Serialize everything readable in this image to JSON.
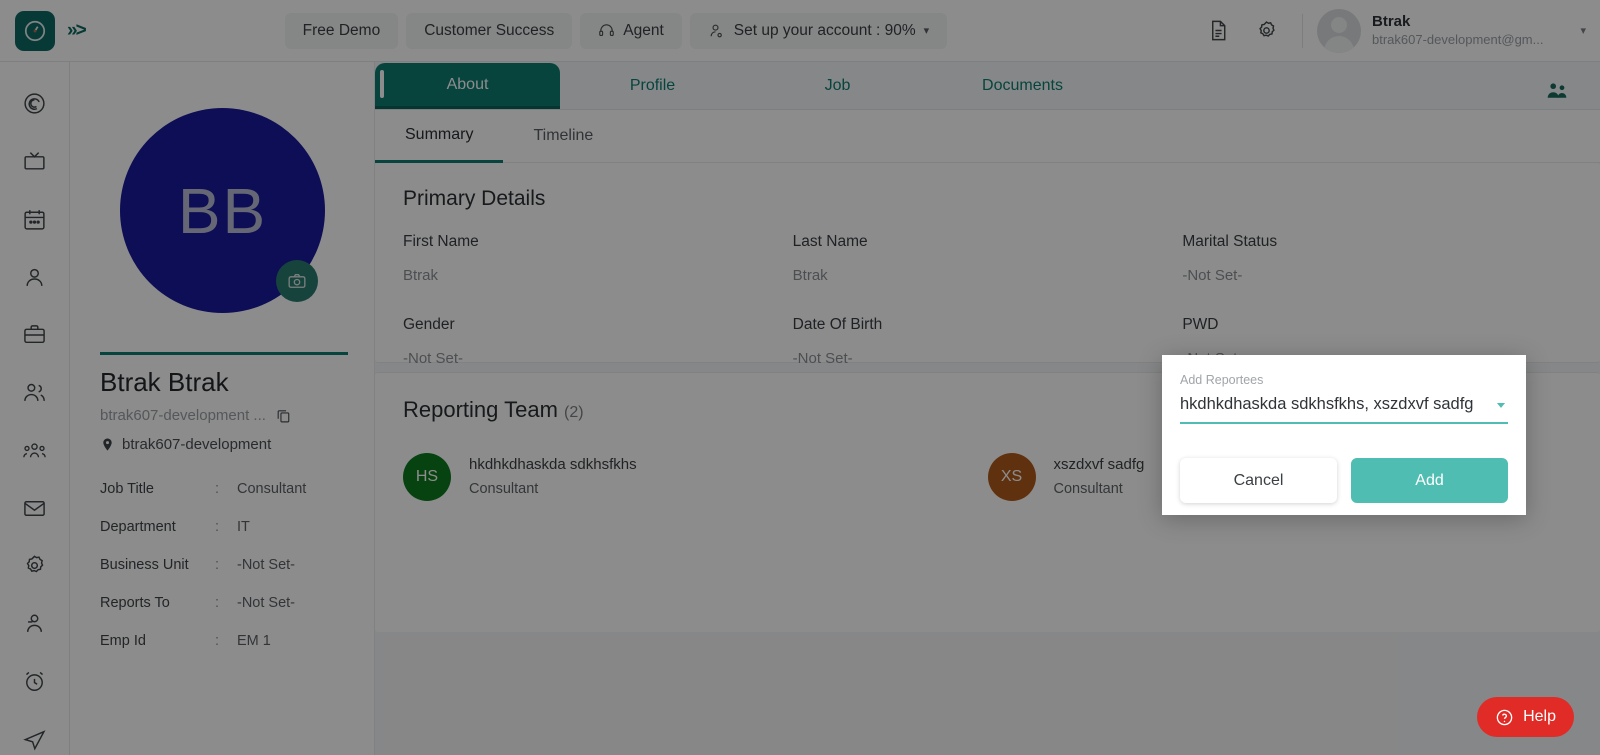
{
  "brand": {
    "logo_icon": "clock-logo-icon",
    "expand_icon": "chevron-triple-right-icon",
    "accent": "#0e7d72",
    "modal_accent": "#4fbdb2",
    "help_color": "#e02b27"
  },
  "topbar": {
    "nav": [
      {
        "label": "Free Demo",
        "icon": null
      },
      {
        "label": "Customer Success",
        "icon": null
      },
      {
        "label": "Agent",
        "icon": "headset-icon"
      },
      {
        "label": "Set up your account : 90%",
        "icon": "user-check-icon",
        "caret": true
      }
    ],
    "icons": [
      "document-icon",
      "gear-icon"
    ],
    "user": {
      "name": "Btrak",
      "email": "btrak607-development@gm...",
      "avatar_icon": "user-avatar-icon",
      "caret": "▾"
    }
  },
  "sidebar": {
    "items": [
      {
        "name": "dashboard",
        "icon": "spiral-target-icon"
      },
      {
        "name": "monitor",
        "icon": "tv-icon"
      },
      {
        "name": "calendar",
        "icon": "calendar-icon"
      },
      {
        "name": "employee",
        "icon": "person-icon"
      },
      {
        "name": "jobs",
        "icon": "briefcase-icon"
      },
      {
        "name": "people",
        "icon": "two-people-icon"
      },
      {
        "name": "teams",
        "icon": "group-people-icon"
      },
      {
        "name": "mail",
        "icon": "envelope-icon"
      },
      {
        "name": "settings",
        "icon": "gear-icon"
      },
      {
        "name": "account",
        "icon": "person-badge-icon"
      },
      {
        "name": "time",
        "icon": "alarm-clock-icon"
      },
      {
        "name": "send",
        "icon": "paper-plane-icon"
      }
    ]
  },
  "profile": {
    "initials": "BB",
    "camera_icon": "camera-icon",
    "name": "Btrak Btrak",
    "email": "btrak607-development ...",
    "copy_icon": "copy-icon",
    "location_icon": "location-pin-icon",
    "location": "btrak607-development",
    "fields": [
      {
        "label": "Job Title",
        "sep": ":",
        "value": "Consultant"
      },
      {
        "label": "Department",
        "sep": ":",
        "value": "IT"
      },
      {
        "label": "Business Unit",
        "sep": ":",
        "value": "-Not Set-"
      },
      {
        "label": "Reports To",
        "sep": ":",
        "value": "-Not Set-"
      },
      {
        "label": "Emp Id",
        "sep": ":",
        "value": "EM 1"
      }
    ]
  },
  "main": {
    "tabs": [
      {
        "label": "About",
        "active": true
      },
      {
        "label": "Profile",
        "active": false
      },
      {
        "label": "Job",
        "active": false
      },
      {
        "label": "Documents",
        "active": false
      }
    ],
    "subtabs": [
      {
        "label": "Summary",
        "active": true
      },
      {
        "label": "Timeline",
        "active": false
      }
    ],
    "team_icon": "team-people-icon",
    "primary_details": {
      "title": "Primary Details",
      "fields": [
        {
          "label": "First Name",
          "value": "Btrak"
        },
        {
          "label": "Last Name",
          "value": "Btrak"
        },
        {
          "label": "Marital Status",
          "value": "-Not Set-"
        },
        {
          "label": "Gender",
          "value": "-Not Set-"
        },
        {
          "label": "Date Of Birth",
          "value": "-Not Set-"
        },
        {
          "label": "PWD",
          "value": "-Not Set-"
        }
      ]
    },
    "reporting_team": {
      "title": "Reporting Team",
      "count": "(2)",
      "members": [
        {
          "initials": "HS",
          "color": "#0d7a1e",
          "name": "hkdhkdhaskda sdkhsfkhs",
          "role": "Consultant"
        },
        {
          "initials": "XS",
          "color": "#b05a1c",
          "name": "xszdxvf sadfg",
          "role": "Consultant"
        }
      ]
    }
  },
  "modal": {
    "label": "Add Reportees",
    "value": "hkdhkdhaskda sdkhsfkhs, xszdxvf sadfg",
    "caret_icon": "chevron-down-icon",
    "cancel_label": "Cancel",
    "add_label": "Add"
  },
  "help": {
    "label": "Help",
    "icon": "question-circle-icon"
  }
}
